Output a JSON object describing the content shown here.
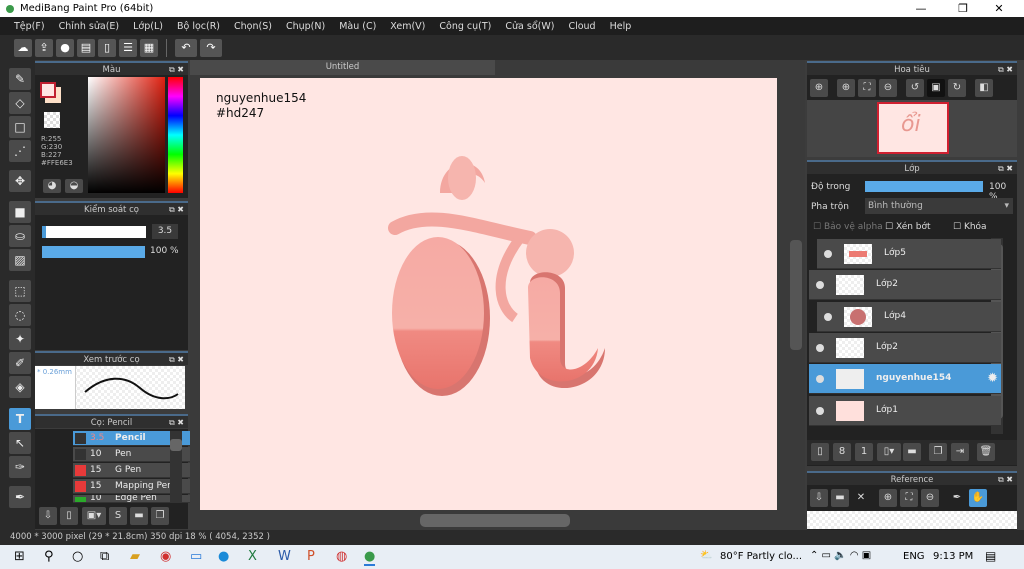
{
  "window": {
    "title": "MediBang Paint Pro (64bit)",
    "minimize": "—",
    "maximize": "❐",
    "close": "✕"
  },
  "menu": [
    "Tệp(F)",
    "Chỉnh sửa(E)",
    "Lớp(L)",
    "Bộ lọc(R)",
    "Chọn(S)",
    "Chụp(N)",
    "Màu (C)",
    "Xem(V)",
    "Công cụ(T)",
    "Cửa sổ(W)",
    "Cloud",
    "Help"
  ],
  "toolbar_icons": [
    "cloud-icon",
    "share-icon",
    "comment-icon",
    "chat-icon",
    "page-icon",
    "grid-icon",
    "layout-icon"
  ],
  "color_panel": {
    "title": "Màu",
    "r": "R:255",
    "g": "G:230",
    "b": "B:227",
    "hex": "#FFE6E3",
    "primary": "#ffe6e3",
    "secondary": "#fde0c8"
  },
  "brush_control": {
    "title": "Kiểm soát cọ",
    "size": "3.5",
    "opacity": "100 %",
    "size_fraction": 0.035,
    "opacity_fraction": 1.0
  },
  "brush_preview": {
    "title": "Xem trước cọ",
    "size_label": "* 0.26mm"
  },
  "brush_list": {
    "title": "Cọ: Pencil",
    "items": [
      {
        "size": "3.5",
        "name": "Pencil",
        "color": "#333333",
        "selected": true
      },
      {
        "size": "10",
        "name": "Pen",
        "color": "#333333"
      },
      {
        "size": "15",
        "name": "G Pen",
        "color": "#e83a3a"
      },
      {
        "size": "15",
        "name": "Mapping Pen",
        "color": "#e83a3a"
      },
      {
        "size": "10",
        "name": "Edge Pen",
        "color": "#2aaa2a"
      }
    ]
  },
  "document": {
    "tab": "Untitled",
    "text_line1": "nguyenhue154",
    "text_line2": "#hd247",
    "canvas_color": "#ffe6e3"
  },
  "navigator": {
    "title": "Hoa tiêu"
  },
  "layers_panel": {
    "title": "Lớp",
    "opacity_label": "Độ trong",
    "opacity_value": "100 %",
    "blend_label": "Pha trộn",
    "blend_value": "Bình thường",
    "protect_alpha": "Bảo vệ alpha",
    "clip": "Xén bớt",
    "lock": "Khóa",
    "layers": [
      {
        "name": "Lớp5",
        "indent": true
      },
      {
        "name": "Lớp2",
        "indent": false
      },
      {
        "name": "Lớp4",
        "indent": true
      },
      {
        "name": "Lớp2",
        "indent": false
      },
      {
        "name": "nguyenhue154",
        "indent": false,
        "selected": true
      },
      {
        "name": "Lớp1",
        "indent": false
      }
    ]
  },
  "reference": {
    "title": "Reference"
  },
  "status": {
    "text": "4000 * 3000 pixel   (29 * 21.8cm)   350 dpi   18 %   ( 4054, 2352 )"
  },
  "taskbar": {
    "weather": "80°F  Partly clo...",
    "lang": "ENG",
    "time": "9:13 PM"
  },
  "accent": "#4a9ad8"
}
